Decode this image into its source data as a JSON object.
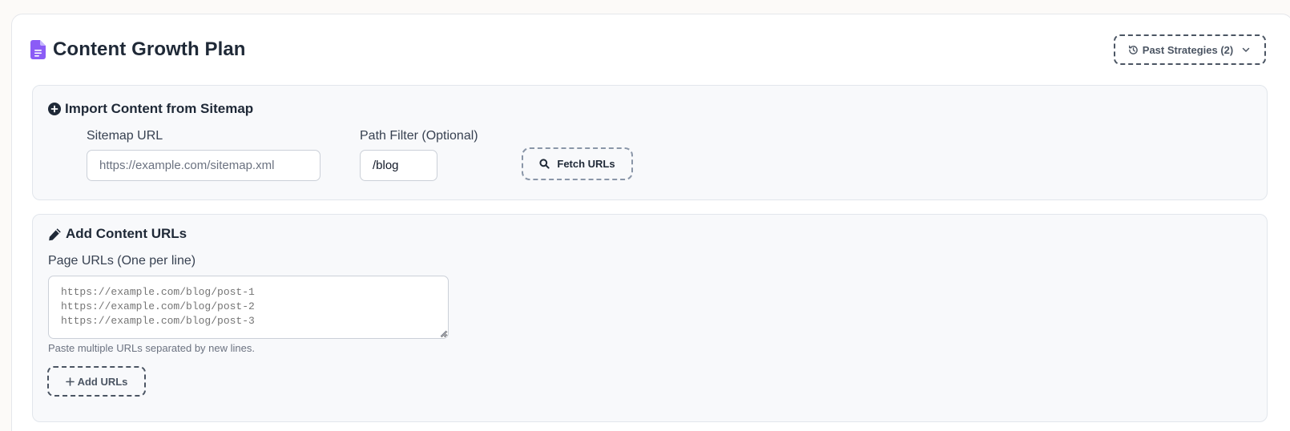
{
  "header": {
    "title": "Content Growth Plan",
    "title_icon": "document-icon",
    "past_strategies_label": "Past Strategies (2)"
  },
  "colors": {
    "accent_purple": "#8b5cf6",
    "text_dark": "#1f2937",
    "border_dashed": "#4b5563",
    "section_bg": "#f8f9fb"
  },
  "sitemap_section": {
    "title": "Import Content from Sitemap",
    "title_icon": "plus-circle-icon",
    "sitemap_url_label": "Sitemap URL",
    "sitemap_url_placeholder": "https://example.com/sitemap.xml",
    "sitemap_url_value": "",
    "path_filter_label": "Path Filter (Optional)",
    "path_filter_value": "/blog",
    "fetch_button_label": "Fetch URLs",
    "fetch_button_icon": "search-icon"
  },
  "content_urls_section": {
    "title": "Add Content URLs",
    "title_icon": "pencil-icon",
    "page_urls_label": "Page URLs (One per line)",
    "page_urls_placeholder": "https://example.com/blog/post-1\nhttps://example.com/blog/post-2\nhttps://example.com/blog/post-3",
    "helper_text": "Paste multiple URLs separated by new lines.",
    "add_button_label": "Add URLs",
    "add_button_icon": "plus-icon"
  }
}
